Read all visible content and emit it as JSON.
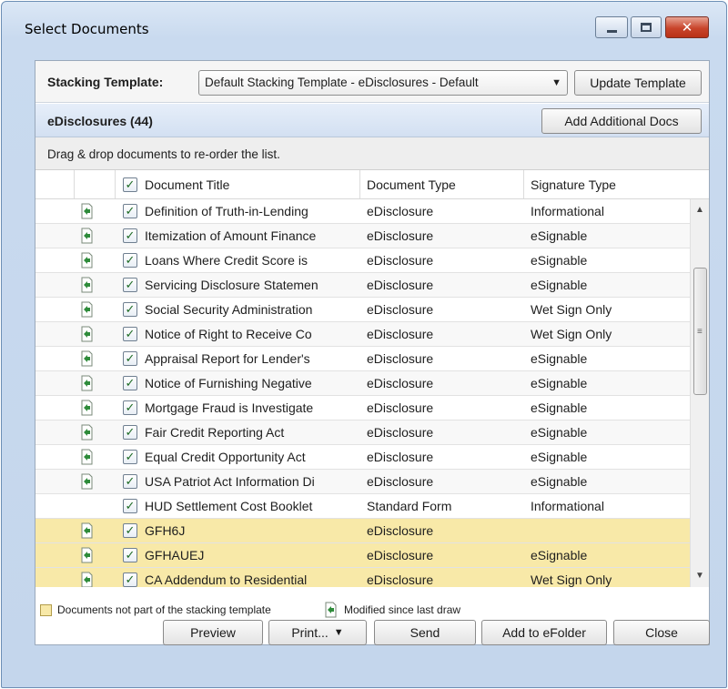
{
  "window": {
    "title": "Select Documents",
    "minimize_label": "",
    "maximize_label": "",
    "close_label": "✕"
  },
  "stacking": {
    "label": "Stacking Template:",
    "selected": "Default Stacking Template - eDisclosures - Default",
    "update_button": "Update Template"
  },
  "section": {
    "title": "eDisclosures (44)",
    "add_button": "Add Additional Docs"
  },
  "hint": "Drag & drop documents to re-order the list.",
  "table": {
    "headers": [
      "Document Title",
      "Document Type",
      "Signature Type"
    ],
    "rows": [
      {
        "title": "Definition of Truth-in-Lending",
        "type": "eDisclosure",
        "sig": "Informational",
        "modified": true,
        "checked": true,
        "highlight": false
      },
      {
        "title": "Itemization of Amount Finance",
        "type": "eDisclosure",
        "sig": "eSignable",
        "modified": true,
        "checked": true,
        "highlight": false
      },
      {
        "title": "Loans Where Credit Score is",
        "type": "eDisclosure",
        "sig": "eSignable",
        "modified": true,
        "checked": true,
        "highlight": false
      },
      {
        "title": "Servicing Disclosure Statemen",
        "type": "eDisclosure",
        "sig": "eSignable",
        "modified": true,
        "checked": true,
        "highlight": false
      },
      {
        "title": "Social Security Administration",
        "type": "eDisclosure",
        "sig": "Wet Sign Only",
        "modified": true,
        "checked": true,
        "highlight": false
      },
      {
        "title": "Notice of Right to Receive Co",
        "type": "eDisclosure",
        "sig": "Wet Sign Only",
        "modified": true,
        "checked": true,
        "highlight": false
      },
      {
        "title": "Appraisal Report for Lender's",
        "type": "eDisclosure",
        "sig": "eSignable",
        "modified": true,
        "checked": true,
        "highlight": false
      },
      {
        "title": "Notice of Furnishing Negative",
        "type": "eDisclosure",
        "sig": "eSignable",
        "modified": true,
        "checked": true,
        "highlight": false
      },
      {
        "title": "Mortgage Fraud is Investigate",
        "type": "eDisclosure",
        "sig": "eSignable",
        "modified": true,
        "checked": true,
        "highlight": false
      },
      {
        "title": "Fair Credit Reporting Act",
        "type": "eDisclosure",
        "sig": "eSignable",
        "modified": true,
        "checked": true,
        "highlight": false
      },
      {
        "title": "Equal Credit Opportunity Act",
        "type": "eDisclosure",
        "sig": "eSignable",
        "modified": true,
        "checked": true,
        "highlight": false
      },
      {
        "title": "USA Patriot Act Information Di",
        "type": "eDisclosure",
        "sig": "eSignable",
        "modified": true,
        "checked": true,
        "highlight": false
      },
      {
        "title": "HUD Settlement Cost Booklet",
        "type": "Standard Form",
        "sig": "Informational",
        "modified": false,
        "checked": true,
        "highlight": false
      },
      {
        "title": "GFH6J",
        "type": "eDisclosure",
        "sig": "",
        "modified": true,
        "checked": true,
        "highlight": true
      },
      {
        "title": "GFHAUEJ",
        "type": "eDisclosure",
        "sig": "eSignable",
        "modified": true,
        "checked": true,
        "highlight": true
      },
      {
        "title": "CA Addendum to Residential",
        "type": "eDisclosure",
        "sig": "Wet Sign Only",
        "modified": true,
        "checked": true,
        "highlight": true
      }
    ]
  },
  "legend": {
    "not_in_template": "Documents not part of the stacking template",
    "modified": "Modified since last draw"
  },
  "footer": {
    "preview": "Preview",
    "print": "Print...",
    "send": "Send",
    "add_efolder": "Add to eFolder",
    "close": "Close"
  },
  "colors": {
    "highlight_row": "#f8e9a8",
    "check_green": "#1d6b24",
    "doc_icon_green": "#2e8b3a"
  },
  "icons": {
    "move_up": "arrow-up-icon",
    "move_down": "arrow-down-icon",
    "modified_doc": "document-modified-icon",
    "dropdown": "chevron-down-icon"
  }
}
